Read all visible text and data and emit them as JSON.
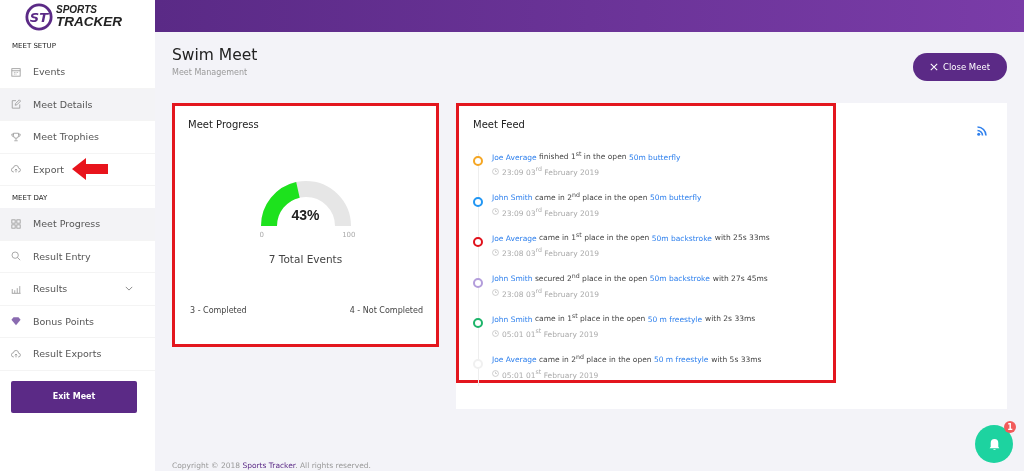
{
  "logo": {
    "monogram": "ST",
    "line_1": "SPORTS",
    "line_2": "TRACKER"
  },
  "sidebar": {
    "sections": [
      {
        "title": "MEET SETUP",
        "items": [
          {
            "label": "Events",
            "kind": "calendar",
            "selected": false,
            "has_submenu": false,
            "pointed": false
          },
          {
            "label": "Meet Details",
            "kind": "edit",
            "selected": true,
            "has_submenu": false,
            "pointed": false
          },
          {
            "label": "Meet Trophies",
            "kind": "trophy",
            "selected": false,
            "has_submenu": false,
            "pointed": false
          },
          {
            "label": "Export",
            "kind": "cloud",
            "selected": false,
            "has_submenu": false,
            "pointed": true
          }
        ]
      },
      {
        "title": "MEET DAY",
        "items": [
          {
            "label": "Meet Progress",
            "kind": "grid",
            "selected": true,
            "has_submenu": false,
            "pointed": false
          },
          {
            "label": "Result Entry",
            "kind": "search",
            "selected": false,
            "has_submenu": false,
            "pointed": false
          },
          {
            "label": "Results",
            "kind": "chart",
            "selected": false,
            "has_submenu": true,
            "pointed": false
          },
          {
            "label": "Bonus Points",
            "kind": "diamond",
            "selected": false,
            "has_submenu": false,
            "pointed": false
          },
          {
            "label": "Result Exports",
            "kind": "cloud",
            "selected": false,
            "has_submenu": false,
            "pointed": false
          }
        ]
      }
    ],
    "exit_button": "Exit Meet"
  },
  "page": {
    "title": "Swim Meet",
    "subtitle": "Meet Management",
    "close_button": "Close Meet"
  },
  "progress_card": {
    "title": "Meet Progress",
    "highlighted": true,
    "gauge": {
      "level": 0.43,
      "reading": "43%",
      "min_label": "0",
      "max_label": "100"
    },
    "total": "7 Total Events",
    "completed": "3 - Completed",
    "not_completed": "4 - Not Completed"
  },
  "feed_card": {
    "title": "Meet Feed",
    "highlighted": true,
    "items": [
      {
        "color": "#f5a623",
        "player": "Joe Average",
        "action": "finished 1$^{st}$ in the open",
        "event": "50m butterfly",
        "time": "23:09 03$^{rd}$ February 2019"
      },
      {
        "color": "#2196f3",
        "player": "John Smith",
        "action": "came in 2$^{nd}$ place in the open",
        "event": "50m butterfly",
        "time": "23:09 03$^{rd}$ February 2019"
      },
      {
        "color": "#e0111b",
        "player": "Joe Average",
        "action": "came in 1$^{st}$ place in the open",
        "event": "50m backstroke",
        "result": "with 25s 33ms",
        "time": "23:08 03$^{rd}$ February 2019"
      },
      {
        "color": "#b39ddb",
        "player": "John Smith",
        "action": "secured 2$^{nd}$ place in the open",
        "event": "50m backstroke",
        "result": "with 27s 45ms",
        "time": "23:08 03$^{rd}$ February 2019"
      },
      {
        "color": "#1db46a",
        "player": "John Smith",
        "action": "came in 1$^{st}$ place in the open",
        "event": "50 m freestyle",
        "result": "with 2s 33ms",
        "time": "05:01 01$^{st}$ February 2019"
      },
      {
        "color": "#f0f0f0",
        "player": "Joe Average",
        "action": "came in 2$^{nd}$ place in the open",
        "event": "50 m freestyle",
        "result": "with 5s 33ms",
        "time": "05:01 01$^{st}$ February 2019"
      }
    ]
  },
  "footer": {
    "prefix": "Copyright © 2018",
    "link": "Sports Tracker",
    "suffix": ". All rights reserved."
  },
  "notifications": {
    "count": "1"
  }
}
